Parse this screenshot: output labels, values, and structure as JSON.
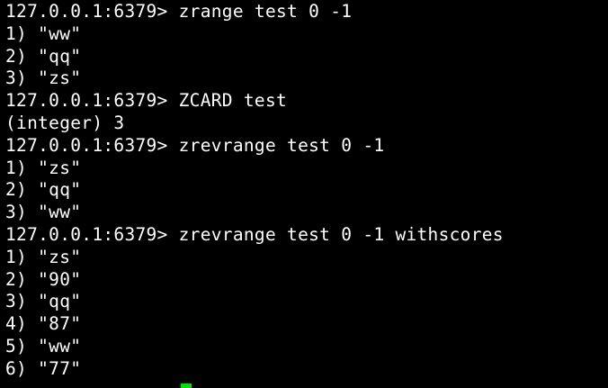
{
  "terminal": {
    "lines": [
      "127.0.0.1:6379> zrange test 0 -1",
      "1) \"ww\"",
      "2) \"qq\"",
      "3) \"zs\"",
      "127.0.0.1:6379> ZCARD test",
      "(integer) 3",
      "127.0.0.1:6379> zrevrange test 0 -1",
      "1) \"zs\"",
      "2) \"qq\"",
      "3) \"ww\"",
      "127.0.0.1:6379> zrevrange test 0 -1 withscores",
      "1) \"zs\"",
      "2) \"90\"",
      "3) \"qq\"",
      "4) \"87\"",
      "5) \"ww\"",
      "6) \"77\""
    ],
    "colors": {
      "background": "#000000",
      "text": "#ffffff",
      "cursor": "#00e000"
    }
  }
}
